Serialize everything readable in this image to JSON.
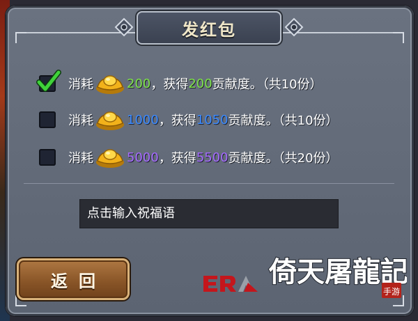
{
  "dialog": {
    "title": "发红包",
    "options": [
      {
        "checked": true,
        "consume_label": "消耗",
        "cost": "200",
        "sep": "，获得",
        "reward": "200",
        "suffix": "贡献度。（共10份）",
        "color": "#7ee34a"
      },
      {
        "checked": false,
        "consume_label": "消耗",
        "cost": "1000",
        "sep": "，获得",
        "reward": "1050",
        "suffix": "贡献度。（共10份）",
        "color": "#3a89ff"
      },
      {
        "checked": false,
        "consume_label": "消耗",
        "cost": "5000",
        "sep": "，获得",
        "reward": "5500",
        "suffix": "贡献度。（共20份）",
        "color": "#a66bff"
      }
    ],
    "blessing_placeholder": "点击输入祝福语",
    "back_label": "返回"
  },
  "branding": {
    "era_logo": "ERA",
    "game_logo": "倚天屠龙记 手游"
  },
  "icons": {
    "currency": "gold-ingot-icon",
    "checked": "green-checkmark-icon"
  }
}
